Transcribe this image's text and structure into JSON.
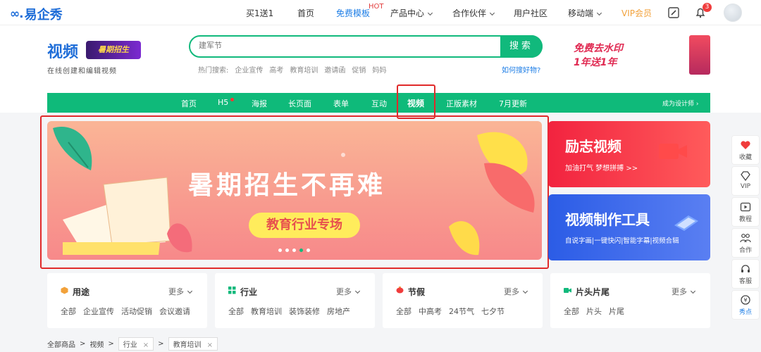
{
  "topbar": {
    "logo_mark": "∞.",
    "logo_text": "易企秀",
    "nav": [
      "买1送1",
      "首页",
      "免费模板",
      "产品中心",
      "合作伙伴",
      "用户社区",
      "移动端",
      "VIP会员"
    ],
    "hot": "HOT",
    "badge": "3"
  },
  "brand": {
    "title": "视频",
    "pic_text": "暑期招生",
    "subtitle": "在线创建和编辑视频"
  },
  "search": {
    "placeholder": "建军节",
    "button": "搜索",
    "hot_label": "热门搜索:",
    "hot_terms": [
      "企业宣传",
      "高考",
      "教育培训",
      "邀请函",
      "促销",
      "妈妈"
    ],
    "how": "如何搜好物?"
  },
  "promo": {
    "line1": "免费去水印",
    "line2": "1年送1年"
  },
  "greennav": {
    "items": [
      "首页",
      "H5",
      "海报",
      "长页面",
      "表单",
      "互动",
      "视频",
      "正版素材",
      "7月更新"
    ],
    "right": "成为设计师 ›"
  },
  "banner": {
    "title": "暑期招生不再难",
    "pill": "教育行业专场"
  },
  "cards": [
    {
      "title": "励志视频",
      "sub": "加油打气 梦想拼搏 >>"
    },
    {
      "title": "视频制作工具",
      "sub": "自说字画|一键快闪|智能字幕|视频合辑"
    }
  ],
  "rightbar": [
    "收藏",
    "VIP",
    "教程",
    "合作",
    "客服",
    "秀点"
  ],
  "categories": [
    {
      "title": "用途",
      "more": "更多",
      "tags": [
        "全部",
        "企业宣传",
        "活动促销",
        "会议邀请"
      ]
    },
    {
      "title": "行业",
      "more": "更多",
      "tags": [
        "全部",
        "教育培训",
        "装饰装修",
        "房地产"
      ]
    },
    {
      "title": "节假",
      "more": "更多",
      "tags": [
        "全部",
        "中高考",
        "24节气",
        "七夕节"
      ]
    },
    {
      "title": "片头片尾",
      "more": "更多",
      "tags": [
        "全部",
        "片头",
        "片尾"
      ]
    }
  ],
  "breadcrumb": {
    "root": "全部商品",
    "sep": ">",
    "level1": "视频",
    "tags": [
      "行业",
      "教育培训"
    ]
  }
}
